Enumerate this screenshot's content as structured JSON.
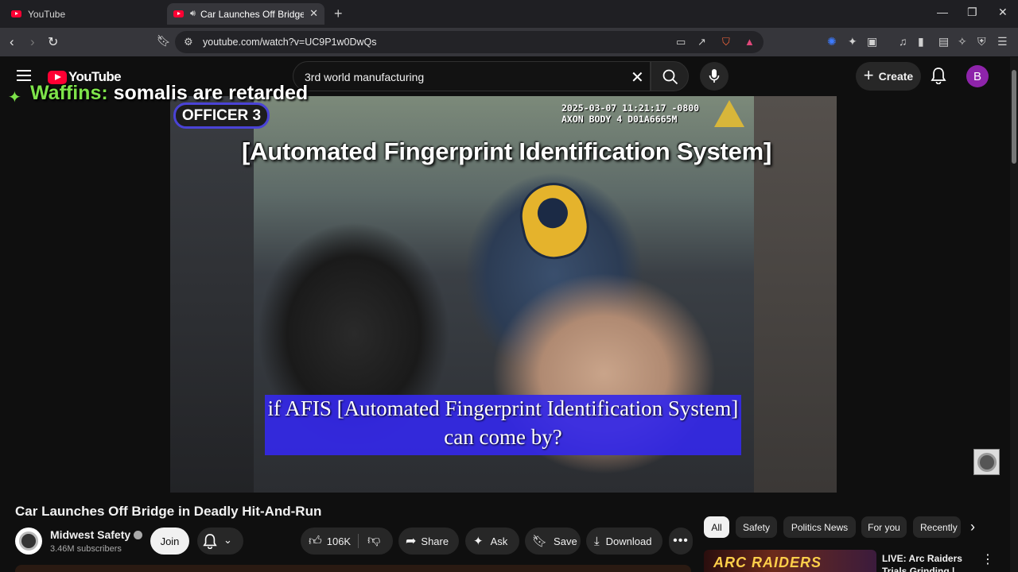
{
  "browser": {
    "tabs": [
      {
        "title": "YouTube",
        "active": false
      },
      {
        "title": "Car Launches Off Bridge in De",
        "active": true
      }
    ],
    "url": "youtube.com/watch?v=UC9P1w0DwQs"
  },
  "header": {
    "logo_text": "YouTube",
    "search_query": "3rd world manufacturing",
    "create_label": "Create",
    "avatar_letter": "B"
  },
  "video": {
    "officer_label": "OFFICER 3",
    "hud_line1": "2025-03-07 11:21:17 -0800",
    "hud_line2": "AXON BODY 4 D01A6665M",
    "top_caption": "[Automated Fingerprint Identification System]",
    "subtitle_line1": "if AFIS [Automated Fingerprint Identification System]",
    "subtitle_line2": "can come by?"
  },
  "chat_overlay": {
    "user": "Waffins:",
    "message": "somalis are retarded"
  },
  "watch": {
    "title": "Car Launches Off Bridge in Deadly Hit-And-Run",
    "channel_name": "Midwest Safety",
    "subscribers": "3.46M subscribers",
    "join_label": "Join",
    "likes": "106K",
    "share_label": "Share",
    "ask_label": "Ask",
    "save_label": "Save",
    "download_label": "Download"
  },
  "chips": [
    "All",
    "Safety",
    "Politics News",
    "For you",
    "Recently"
  ],
  "recommendation": {
    "thumb_text": "ARC RAIDERS",
    "title": "LIVE: Arc Raiders Trials Grinding |"
  },
  "colors": {
    "subtitle_bg": "#3428e8",
    "chat_user": "#7ee34a",
    "yt_red": "#ff0033",
    "avatar_bg": "#8e24aa"
  }
}
